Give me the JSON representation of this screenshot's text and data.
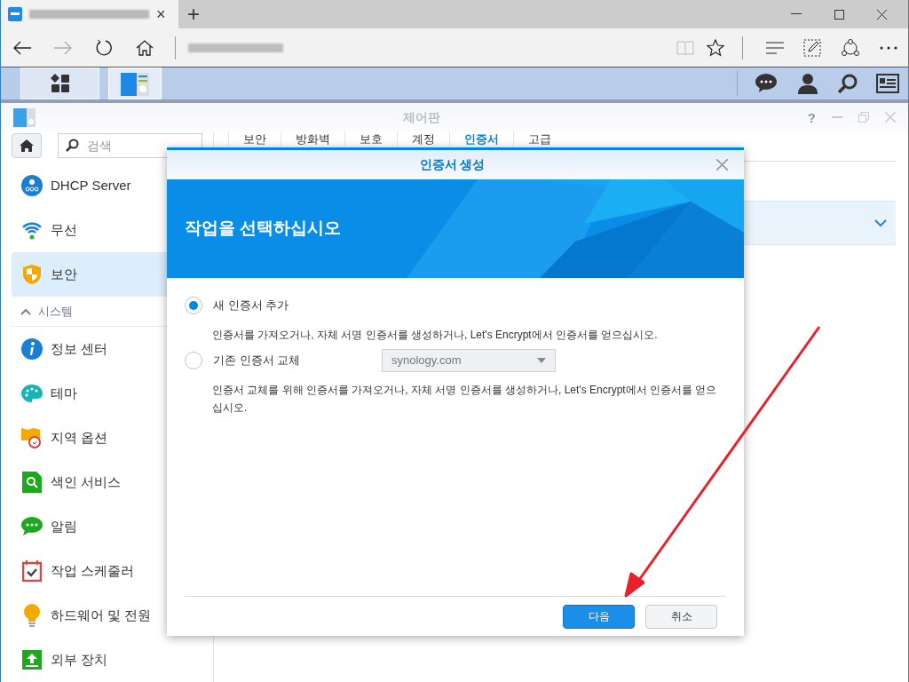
{
  "browser": {
    "tab_close": "×",
    "new_tab": "+"
  },
  "window": {
    "title": "제어판",
    "help": "?",
    "tabs": [
      {
        "label": "보안",
        "selected": false
      },
      {
        "label": "방화벽",
        "selected": false
      },
      {
        "label": "보호",
        "selected": false
      },
      {
        "label": "계정",
        "selected": false
      },
      {
        "label": "인증서",
        "selected": true
      },
      {
        "label": "고급",
        "selected": false
      }
    ]
  },
  "search": {
    "placeholder": "검색"
  },
  "sidebar": {
    "items": [
      {
        "label": "DHCP Server",
        "selected": false
      },
      {
        "label": "무선",
        "selected": false
      },
      {
        "label": "보안",
        "selected": true
      }
    ],
    "section": {
      "title": "시스템",
      "expanded": true,
      "items": [
        {
          "label": "정보 센터",
          "selected": false
        },
        {
          "label": "테마",
          "selected": false
        },
        {
          "label": "지역 옵션",
          "selected": false
        },
        {
          "label": "색인 서비스",
          "selected": false
        },
        {
          "label": "알림",
          "selected": false
        },
        {
          "label": "작업 스케줄러",
          "selected": false
        },
        {
          "label": "하드웨어 및 전원",
          "selected": false
        },
        {
          "label": "외부 장치",
          "selected": false
        }
      ]
    }
  },
  "dialog": {
    "title": "인증서 생성",
    "heading": "작업을 선택하십시오",
    "options": [
      {
        "label": "새 인증서 추가",
        "selected": true,
        "description": "인증서를 가져오거나, 자체 서명 인증서를 생성하거나, Let's Encrypt에서 인증서를 얻으십시오."
      },
      {
        "label": "기존 인증서 교체",
        "selected": false,
        "select_value": "synology.com",
        "description": "인증서 교체를 위해 인증서를 가져오거나, 자체 서명 인증서를 생성하거나, Let's Encrypt에서 인증서를 얻으십시오."
      }
    ],
    "buttons": [
      {
        "label": "다음",
        "kind": "primary"
      },
      {
        "label": "취소",
        "kind": "secondary"
      }
    ]
  }
}
